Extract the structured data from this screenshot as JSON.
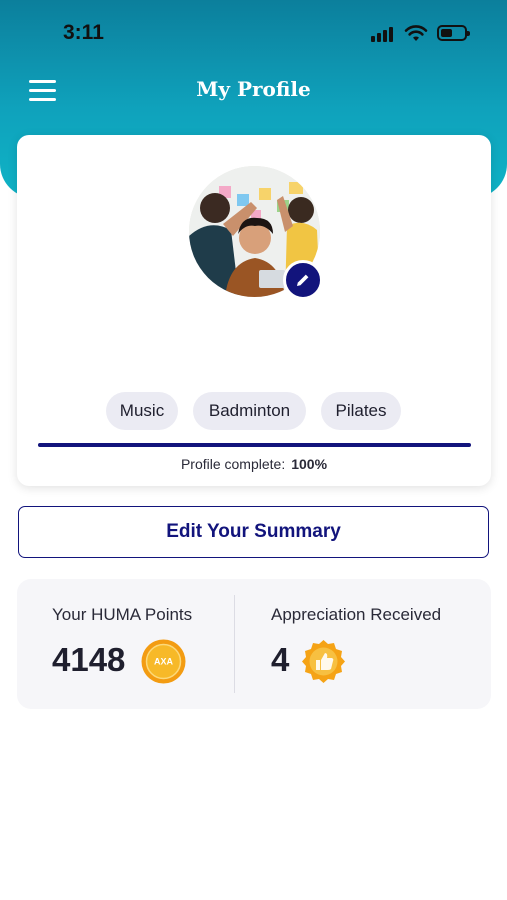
{
  "status_bar": {
    "time": "3:11"
  },
  "header": {
    "title": "My Profile",
    "menu_icon": "hamburger-menu-icon"
  },
  "profile": {
    "avatar_icon": "profile-photo",
    "edit_icon": "pencil-icon",
    "interests": [
      "Music",
      "Badminton",
      "Pilates"
    ],
    "progress_label": "Profile complete:",
    "progress_value": "100%",
    "progress_fraction": 1.0
  },
  "actions": {
    "edit_summary_label": "Edit Your Summary"
  },
  "stats": {
    "points": {
      "label": "Your HUMA Points",
      "value": "4148",
      "coin_text": "AXA",
      "icon": "coin-icon"
    },
    "appreciation": {
      "label": "Appreciation Received",
      "value": "4",
      "icon": "thumbs-up-badge-icon"
    }
  },
  "colors": {
    "header_teal": "#0fa2bc",
    "brand_navy": "#12147c",
    "coin_gold": "#f5b31c"
  }
}
